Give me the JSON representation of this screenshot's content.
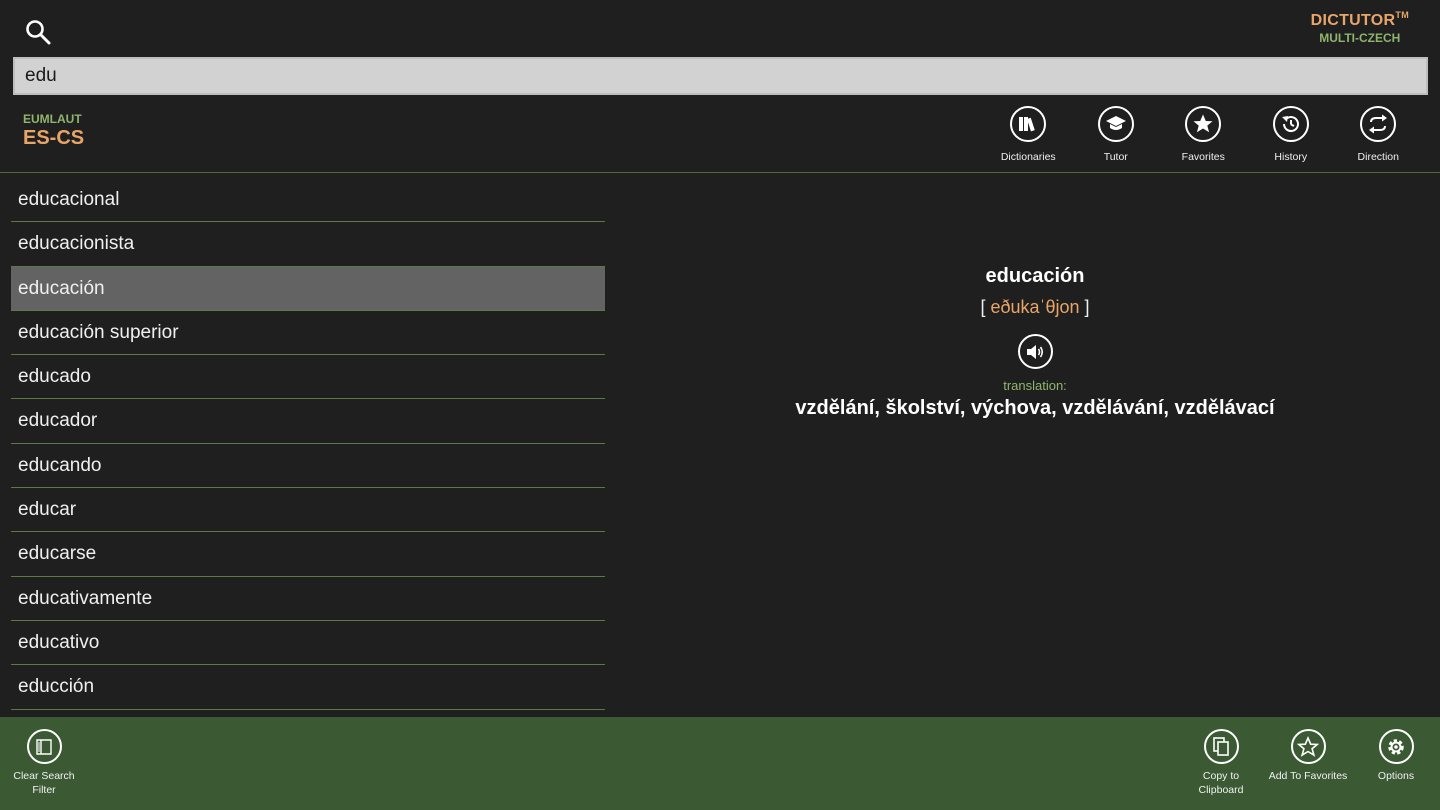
{
  "brand": {
    "name": "DICTUTOR",
    "trademark": "TM",
    "subtitle": "MULTI-CZECH"
  },
  "search": {
    "value": "edu",
    "icon": "search-icon"
  },
  "dictionary": {
    "vendor": "EUMLAUT",
    "pair": "ES-CS"
  },
  "toolbar": [
    {
      "label": "Dictionaries",
      "icon": "books-icon"
    },
    {
      "label": "Tutor",
      "icon": "graduation-cap-icon"
    },
    {
      "label": "Favorites",
      "icon": "star-icon"
    },
    {
      "label": "History",
      "icon": "history-icon"
    },
    {
      "label": "Direction",
      "icon": "swap-direction-icon"
    }
  ],
  "words": [
    "educacional",
    "educacionista",
    "educación",
    "educación superior",
    "educado",
    "educador",
    "educando",
    "educar",
    "educarse",
    "educativamente",
    "educativo",
    "educción"
  ],
  "selected_index": 2,
  "entry": {
    "headword": "educación",
    "phonetic_open": "[ ",
    "phonetic": "eðukaˈθjon",
    "phonetic_close": " ]",
    "translation_label": "translation:",
    "translation": "vzdělání, školství, výchova, vzdělávání, vzdělávací"
  },
  "appbar": {
    "clear_filter": "Clear Search Filter",
    "copy": "Copy to Clipboard",
    "add_favorites": "Add To Favorites",
    "options": "Options"
  },
  "colors": {
    "accent_orange": "#e8a56a",
    "accent_green": "#8fb46e",
    "appbar_bg": "#3b5a33",
    "selected_bg": "#636363"
  }
}
